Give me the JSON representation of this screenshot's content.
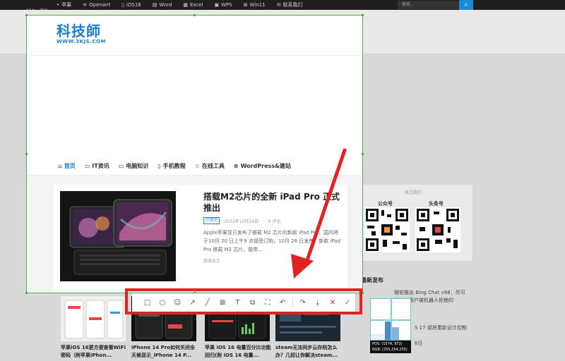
{
  "topbar": {
    "items": [
      {
        "icon": "apple-icon",
        "label": "苹果"
      },
      {
        "icon": "wifi-icon",
        "label": "Openwrt"
      },
      {
        "icon": "phone-icon",
        "label": "iOS16"
      },
      {
        "icon": "word-icon",
        "label": "Word"
      },
      {
        "icon": "excel-icon",
        "label": "Excel"
      },
      {
        "icon": "wps-icon",
        "label": "WPS"
      },
      {
        "icon": "windows-icon",
        "label": "Win11"
      },
      {
        "icon": "mail-icon",
        "label": "联系我们"
      }
    ],
    "search_placeholder": "搜索...",
    "search_icon": "search-icon"
  },
  "capture": {
    "size_label": "964 x 798",
    "logo_cn": "科技師",
    "logo_en": "WWW.3KJS.COM",
    "border_color": "#4caf50"
  },
  "menu": {
    "items": [
      {
        "icon": "home-icon",
        "label": "首页",
        "active": true
      },
      {
        "icon": "id-card-icon",
        "label": "IT资讯",
        "active": false
      },
      {
        "icon": "monitor-icon",
        "label": "电脑知识",
        "active": false
      },
      {
        "icon": "mobile-icon",
        "label": "手机教程",
        "active": false
      },
      {
        "icon": "star-icon",
        "label": "在线工具",
        "active": false
      },
      {
        "icon": "wordpress-icon",
        "label": "WordPress&建站",
        "active": false
      }
    ]
  },
  "post": {
    "title": "搭载M2芯片的全新 iPad Pro 正式推出",
    "tag": "IT资讯",
    "date": "2022年10月19日",
    "comments": "0 评论",
    "excerpt": "Apple苹果现已发布了搭载 M2 芯片的新款 iPad Pro，国内将于10月 20 日上午9 点接受订购，10月 26 日发售。新款 iPad Pro 搭载 M2 芯片，能带...",
    "more": "阅读全文"
  },
  "sidebar": {
    "follow_head": "关注我们",
    "qr1_label": "公众号",
    "qr2_label": "头条号",
    "latest_title": "最新发布",
    "latest": [
      "微软推出 Bing Chat v98：尽可能减少用户被机器人拒绝的",
      "S 17 或将重新设计控制",
      "6日"
    ]
  },
  "thumbs": [
    {
      "title": "苹果iOS 16更方便查看WiFi密码（附苹果iPhon...",
      "badge": "IT资讯"
    },
    {
      "title": "iPhone 14 Pro如何关闭全天候显示_iPhone 14 P...",
      "badge": ""
    },
    {
      "title": "苹果 iOS 16 电量百分比功能回归(附 iOS 16 电量...",
      "badge": ""
    },
    {
      "title": "steam无法同步云存档怎么办？几招让你解决steam...",
      "badge": ""
    }
  ],
  "toolbar": {
    "tools": [
      {
        "name": "rectangle-tool",
        "glyph": "□"
      },
      {
        "name": "ellipse-tool",
        "glyph": "○"
      },
      {
        "name": "emoji-tool",
        "glyph": "☺"
      },
      {
        "name": "arrow-tool",
        "glyph": "↗"
      },
      {
        "name": "line-tool",
        "glyph": "╱"
      },
      {
        "name": "mosaic-tool",
        "glyph": "⊠"
      },
      {
        "name": "text-tool",
        "glyph": "T"
      },
      {
        "name": "pin-tool",
        "glyph": "⧉"
      },
      {
        "name": "ocr-tool",
        "glyph": "⛶"
      },
      {
        "name": "undo-tool",
        "glyph": "↶"
      }
    ],
    "actions": [
      {
        "name": "share-button",
        "glyph": "↷"
      },
      {
        "name": "save-button",
        "glyph": "⤓"
      },
      {
        "name": "cancel-button",
        "glyph": "✕"
      },
      {
        "name": "confirm-button",
        "glyph": "✓"
      }
    ],
    "highlight_color": "#e32222"
  },
  "magnifier": {
    "pos": "POS:  (1574, 972)",
    "rgb": "RGB:  (255,254,255)"
  }
}
